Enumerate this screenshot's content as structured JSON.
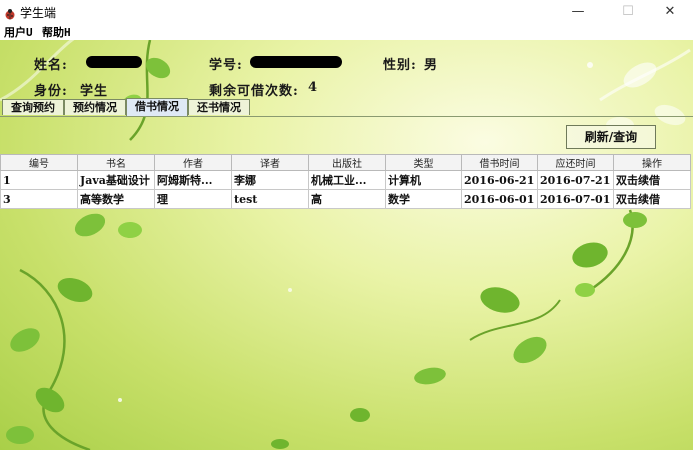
{
  "window": {
    "title": "学生端",
    "minimize_glyph": "—",
    "maximize_glyph": "☐",
    "close_glyph": "✕",
    "app_icon": "ladybug-icon"
  },
  "menu": {
    "items": [
      "用户U",
      "帮助H"
    ]
  },
  "student_info": {
    "name_label": "姓名:",
    "id_label": "学号:",
    "gender_label": "性别:",
    "gender_value": "男",
    "identity_label": "身份:",
    "identity_value": "学生",
    "remaining_label": "剩余可借次数:",
    "remaining_value": "4"
  },
  "tabs": [
    {
      "label": "查询预约",
      "active": false
    },
    {
      "label": "预约情况",
      "active": false
    },
    {
      "label": "借书情况",
      "active": true
    },
    {
      "label": "还书情况",
      "active": false
    }
  ],
  "refresh_button": "刷新/查询",
  "table": {
    "columns": [
      "编号",
      "书名",
      "作者",
      "译者",
      "出版社",
      "类型",
      "借书时间",
      "应还时间",
      "操作"
    ],
    "rows": [
      [
        "1",
        "Java基础设计",
        "阿姆斯特...",
        "李娜",
        "机械工业...",
        "计算机",
        "2016-06-21",
        "2016-07-21",
        "双击续借"
      ],
      [
        "3",
        "高等数学",
        "理",
        "test",
        "高",
        "数学",
        "2016-06-01",
        "2016-07-01",
        "双击续借"
      ]
    ]
  }
}
